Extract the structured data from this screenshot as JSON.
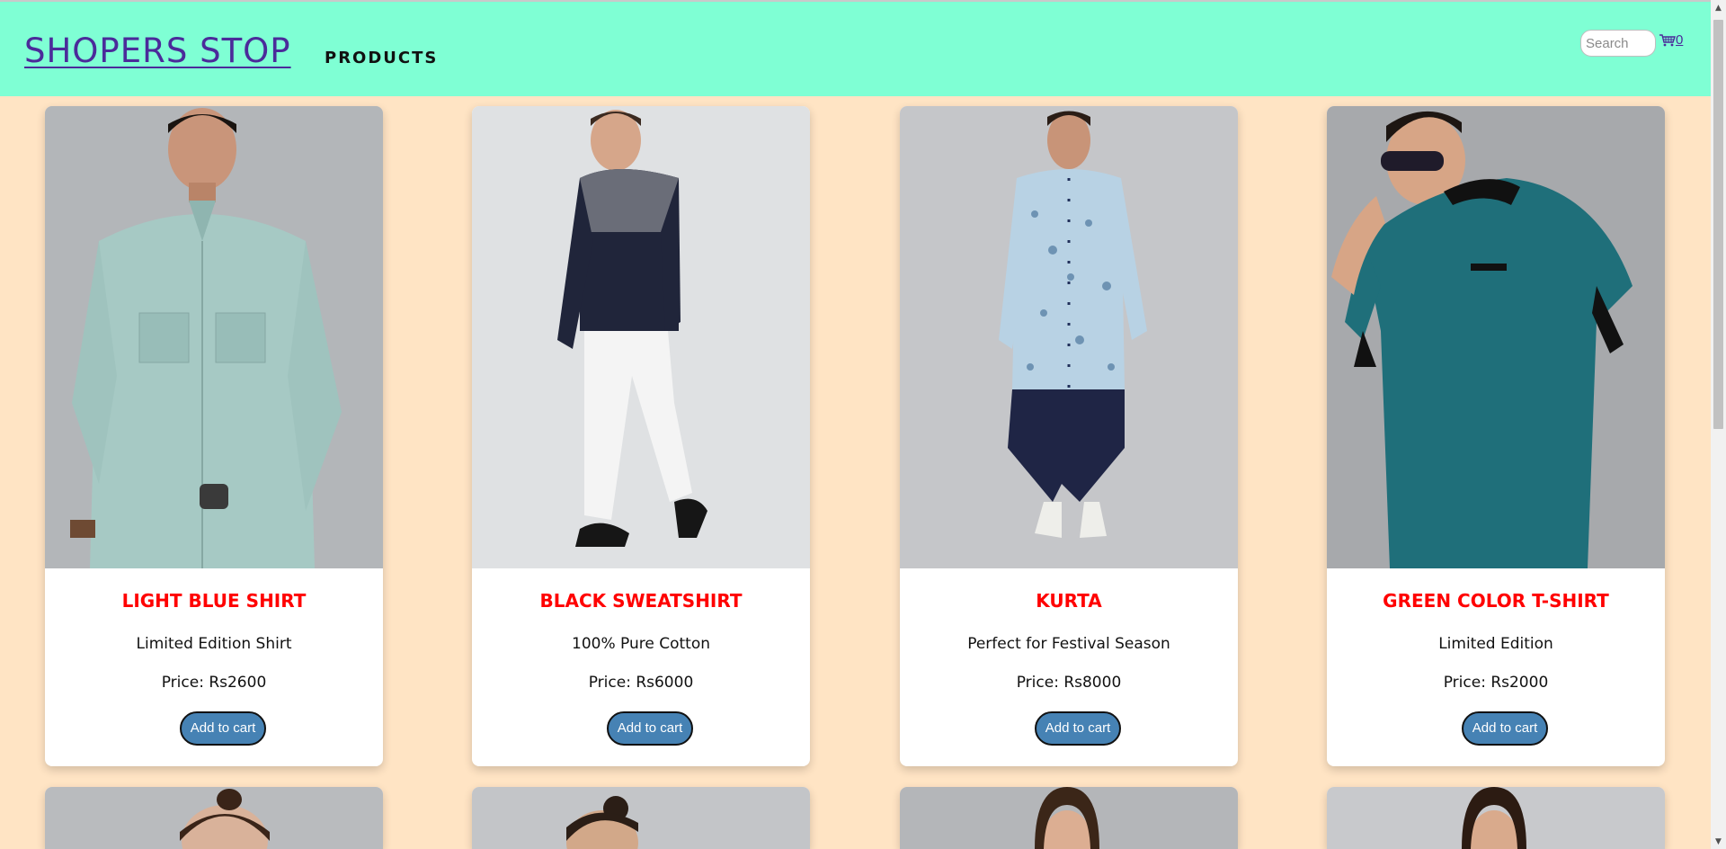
{
  "header": {
    "brand": "SHOPERS STOP",
    "nav_products": "PRODUCTS",
    "search_placeholder": "Search",
    "cart_count": "0",
    "background": "#7fffd4"
  },
  "page": {
    "background": "#ffe4c4"
  },
  "products": [
    {
      "title": "LIGHT BLUE SHIRT",
      "description": "Limited Edition Shirt",
      "price": "Price: Rs2600",
      "button": "Add to cart",
      "image": "light-blue-shirt-model-photo"
    },
    {
      "title": "BLACK SWEATSHIRT",
      "description": "100% Pure Cotton",
      "price": "Price: Rs6000",
      "button": "Add to cart",
      "image": "black-sweatshirt-model-photo"
    },
    {
      "title": "KURTA",
      "description": "Perfect for Festival Season",
      "price": "Price: Rs8000",
      "button": "Add to cart",
      "image": "kurta-model-photo"
    },
    {
      "title": "GREEN COLOR T-SHIRT",
      "description": "Limited Edition",
      "price": "Price: Rs2000",
      "button": "Add to cart",
      "image": "green-tshirt-model-photo"
    }
  ],
  "colors": {
    "title_red": "#ff0000",
    "button_blue": "#4682b4",
    "brand_purple": "#4b2b9a"
  }
}
